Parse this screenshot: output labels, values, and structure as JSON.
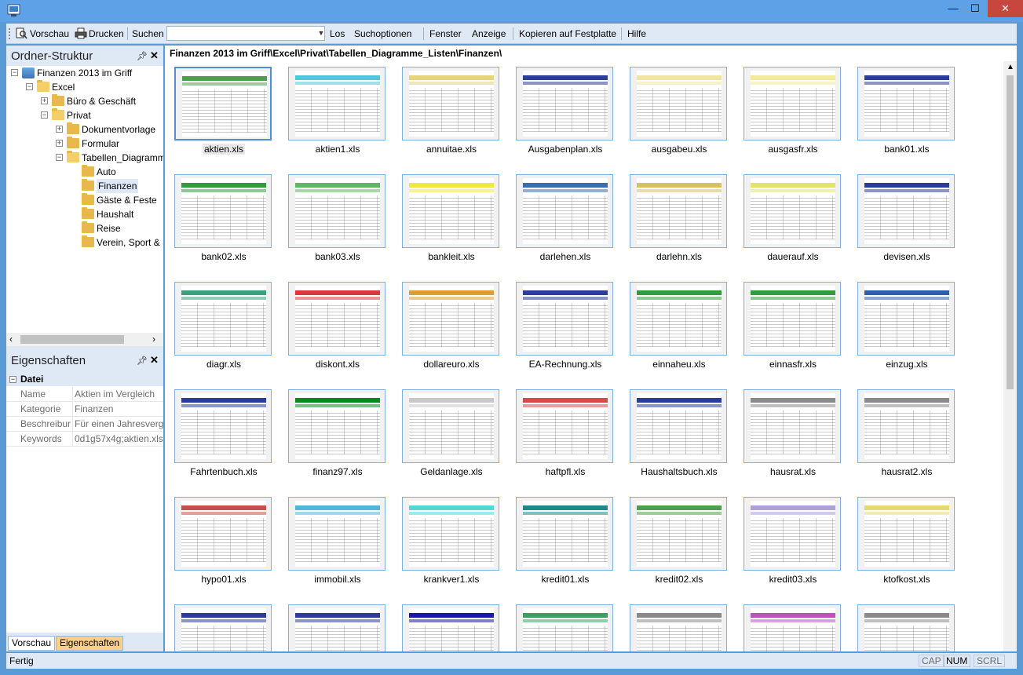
{
  "window": {
    "minimize": "—",
    "maximize": "☐",
    "close": "✕"
  },
  "toolbar": {
    "preview": "Vorschau",
    "print": "Drucken",
    "search_label": "Suchen",
    "search_value": "",
    "go": "Los",
    "search_options": "Suchoptionen",
    "window_menu": "Fenster",
    "view_menu": "Anzeige",
    "copy_to_disk": "Kopieren auf Festplatte",
    "help": "Hilfe"
  },
  "folder_panel": {
    "title": "Ordner-Struktur",
    "tree": [
      {
        "label": "Finanzen 2013 im Griff",
        "level": 0,
        "expander": "−",
        "icon": "root-icon"
      },
      {
        "label": "Excel",
        "level": 1,
        "expander": "−"
      },
      {
        "label": "Büro & Geschäft",
        "level": 2,
        "expander": "+"
      },
      {
        "label": "Privat",
        "level": 2,
        "expander": "−"
      },
      {
        "label": "Dokumentvorlage",
        "level": 3,
        "expander": "+"
      },
      {
        "label": "Formular",
        "level": 3,
        "expander": "+"
      },
      {
        "label": "Tabellen_Diagramme_Listen",
        "level": 3,
        "expander": "−"
      },
      {
        "label": "Auto",
        "level": 4,
        "expander": ""
      },
      {
        "label": "Finanzen",
        "level": 4,
        "expander": "",
        "selected": true
      },
      {
        "label": "Gäste & Feste",
        "level": 4,
        "expander": ""
      },
      {
        "label": "Haushalt",
        "level": 4,
        "expander": ""
      },
      {
        "label": "Reise",
        "level": 4,
        "expander": ""
      },
      {
        "label": "Verein, Sport & Freizeit",
        "level": 4,
        "expander": ""
      }
    ]
  },
  "properties_panel": {
    "title": "Eigenschaften",
    "category": "Datei",
    "rows": [
      {
        "key": "Name",
        "value": "Aktien im Vergleich"
      },
      {
        "key": "Kategorie",
        "value": "Finanzen"
      },
      {
        "key": "Beschreibung",
        "value": "Für einen Jahresvergleich"
      },
      {
        "key": "Keywords",
        "value": "0d1g57x4g;aktien.xls;"
      }
    ]
  },
  "bottom_tabs": {
    "preview": "Vorschau",
    "properties": "Eigenschaften"
  },
  "path": "Finanzen 2013 im Griff\\Excel\\Privat\\Tabellen_Diagramme_Listen\\Finanzen\\",
  "files": [
    {
      "name": "aktien.xls",
      "accent": "#4f9e4f",
      "selected": true
    },
    {
      "name": "aktien1.xls",
      "accent": "#4fc8d8"
    },
    {
      "name": "annuitae.xls",
      "accent": "#e6d47a"
    },
    {
      "name": "Ausgabenplan.xls",
      "accent": "#2a3d9c"
    },
    {
      "name": "ausgabeu.xls",
      "accent": "#f0e6a0"
    },
    {
      "name": "ausgasfr.xls",
      "accent": "#f3eb9a"
    },
    {
      "name": "bank01.xls",
      "accent": "#2a3d9c"
    },
    {
      "name": "bank02.xls",
      "accent": "#2f9e3a"
    },
    {
      "name": "bank03.xls",
      "accent": "#5fb85f"
    },
    {
      "name": "bankleit.xls",
      "accent": "#f2e640"
    },
    {
      "name": "darlehen.xls",
      "accent": "#3b6bb0"
    },
    {
      "name": "darlehn.xls",
      "accent": "#d9c060"
    },
    {
      "name": "dauerauf.xls",
      "accent": "#e3e36a"
    },
    {
      "name": "devisen.xls",
      "accent": "#2a3d9c"
    },
    {
      "name": "diagr.xls",
      "accent": "#3aa080"
    },
    {
      "name": "diskont.xls",
      "accent": "#d83a3a"
    },
    {
      "name": "dollareuro.xls",
      "accent": "#d8a030"
    },
    {
      "name": "EA-Rechnung.xls",
      "accent": "#2a3d9c"
    },
    {
      "name": "einnaheu.xls",
      "accent": "#2f9e3a"
    },
    {
      "name": "einnasfr.xls",
      "accent": "#2f9e3a"
    },
    {
      "name": "einzug.xls",
      "accent": "#2a5fb0"
    },
    {
      "name": "Fahrtenbuch.xls",
      "accent": "#2a3d9c"
    },
    {
      "name": "finanz97.xls",
      "accent": "#0a8a1e"
    },
    {
      "name": "Geldanlage.xls",
      "accent": "#c8c8c8"
    },
    {
      "name": "haftpfl.xls",
      "accent": "#d84a4a"
    },
    {
      "name": "Haushaltsbuch.xls",
      "accent": "#2a3d9c"
    },
    {
      "name": "hausrat.xls",
      "accent": "#8a8a8a"
    },
    {
      "name": "hausrat2.xls",
      "accent": "#8a8a8a"
    },
    {
      "name": "hypo01.xls",
      "accent": "#c8504a"
    },
    {
      "name": "immobil.xls",
      "accent": "#4fb8d8"
    },
    {
      "name": "krankver1.xls",
      "accent": "#4fd8d8"
    },
    {
      "name": "kredit01.xls",
      "accent": "#1a8a8a"
    },
    {
      "name": "kredit02.xls",
      "accent": "#4f9e4f"
    },
    {
      "name": "kredit03.xls",
      "accent": "#b0a0d8"
    },
    {
      "name": "ktofkost.xls",
      "accent": "#e8d870"
    },
    {
      "name": "",
      "accent": "#2a3d9c"
    },
    {
      "name": "",
      "accent": "#2a3d9c"
    },
    {
      "name": "",
      "accent": "#1a1aa0"
    },
    {
      "name": "",
      "accent": "#3aa060"
    },
    {
      "name": "",
      "accent": "#8a8a8a"
    },
    {
      "name": "",
      "accent": "#c050c0"
    },
    {
      "name": "",
      "accent": "#8a8a8a"
    }
  ],
  "status": {
    "text": "Fertig",
    "cap": "CAP",
    "num": "NUM",
    "scrl": "SCRL"
  }
}
